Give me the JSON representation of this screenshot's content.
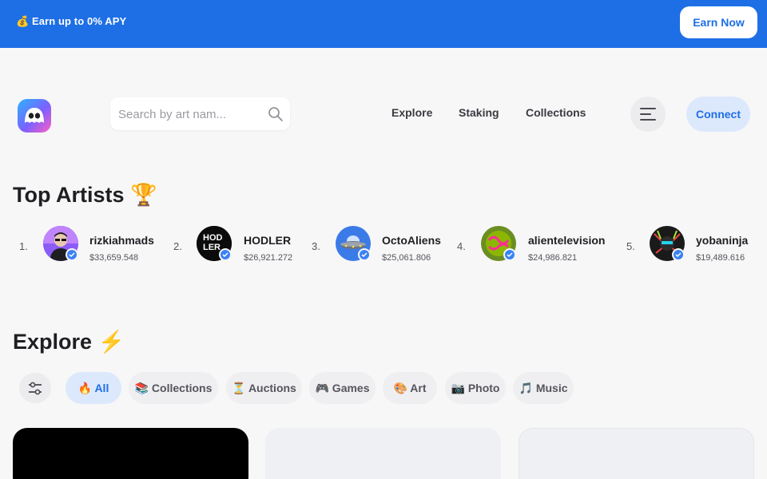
{
  "banner": {
    "text": "💰 Earn up to 0% APY",
    "button": "Earn Now"
  },
  "header": {
    "search_placeholder": "Search by art nam...",
    "nav": [
      "Explore",
      "Staking",
      "Collections"
    ],
    "connect": "Connect"
  },
  "top_artists": {
    "title": "Top Artists 🏆",
    "artists": [
      {
        "rank": "1.",
        "name": "rizkiahmads",
        "value": "$33,659.548"
      },
      {
        "rank": "2.",
        "name": "HODLER",
        "value": "$26,921.272",
        "avatar_text": "HOD LER"
      },
      {
        "rank": "3.",
        "name": "OctoAliens",
        "value": "$25,061.806"
      },
      {
        "rank": "4.",
        "name": "alientelevision",
        "value": "$24,986.821"
      },
      {
        "rank": "5.",
        "name": "yobaninja",
        "value": "$19,489.616"
      }
    ]
  },
  "explore": {
    "title": "Explore ⚡",
    "chips": [
      {
        "label": "🔥 All"
      },
      {
        "label": "📚 Collections"
      },
      {
        "label": "⏳ Auctions"
      },
      {
        "label": "🎮 Games"
      },
      {
        "label": "🎨 Art"
      },
      {
        "label": "📷 Photo"
      },
      {
        "label": "🎵 Music"
      }
    ]
  },
  "colors": {
    "accent": "#1e6fe6",
    "accent_light": "#dce8fb",
    "verified": "#3b82f6"
  }
}
